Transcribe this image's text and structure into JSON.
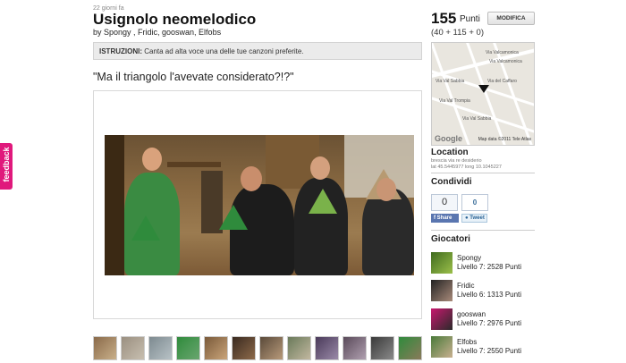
{
  "feedback_tab": "feedback",
  "challenge": {
    "posted": "22 giorni fa",
    "title": "Usignolo neomelodico",
    "byline": "by Spongy , Fridic, gooswan, Elfobs",
    "instructions_label": "ISTRUZIONI:",
    "instructions_text": "Canta ad alta voce una delle tue canzoni preferite.",
    "quote": "\"Ma il triangolo l'avevate considerato?!?\""
  },
  "thumbnails": [
    "thumb-1",
    "thumb-2",
    "thumb-3",
    "thumb-4",
    "thumb-5",
    "thumb-6",
    "thumb-7",
    "thumb-8",
    "thumb-9",
    "thumb-10",
    "thumb-11",
    "thumb-12"
  ],
  "score": {
    "points": "155",
    "points_label": "Punti",
    "breakdown": "(40 + 115 + 0)",
    "edit_button": "MODIFICA"
  },
  "map": {
    "streets": [
      "Via Valcamonica",
      "Via Valcamonica",
      "Via Val Sabbia",
      "Via del Caffaro",
      "Via Val Trompia",
      "Via Val Sabbia"
    ],
    "logo": "Google",
    "attribution": "Map data ©2011 Tele Atlas"
  },
  "location": {
    "heading": "Location",
    "address": "brescia via re desiderio",
    "coords": "lat 45.5445977 long 10.1045227"
  },
  "share": {
    "heading": "Condividi",
    "fb_count": "0",
    "tw_count": "0",
    "fb_label": "Share",
    "tw_label": "Tweet"
  },
  "players": {
    "heading": "Giocatori",
    "list": [
      {
        "name": "Spongy",
        "level": "Livello 7: 2528 Punti"
      },
      {
        "name": "Fridic",
        "level": "Livello 6: 1313 Punti"
      },
      {
        "name": "gooswan",
        "level": "Livello 7: 2976 Punti"
      },
      {
        "name": "Elfobs",
        "level": "Livello 7: 2550 Punti"
      }
    ]
  },
  "colors": {
    "feedback": "#e0197c",
    "triangle_green": "#2f8b3c",
    "facebook": "#5a76b0"
  }
}
